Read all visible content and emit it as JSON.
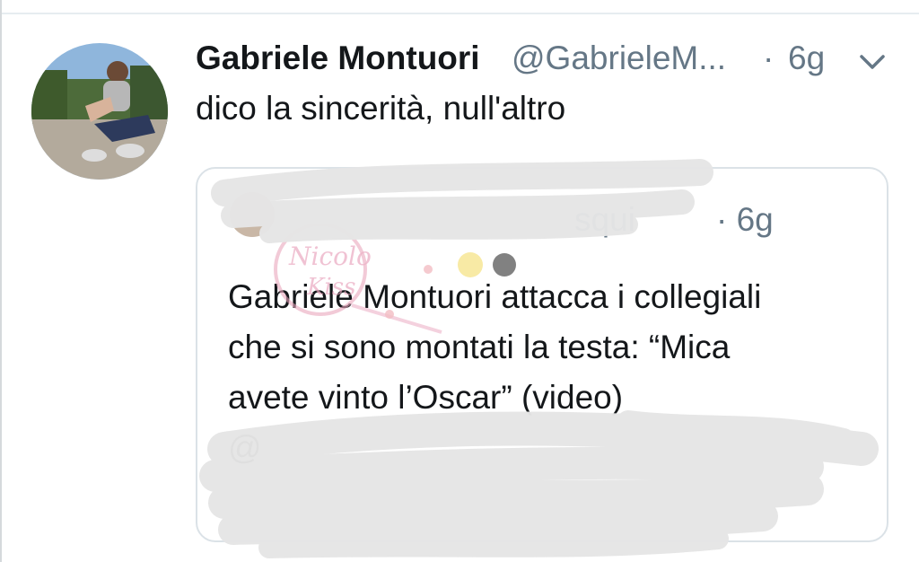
{
  "tweet": {
    "author_name": "Gabriele Montuori",
    "author_handle": "@GabrieleM...",
    "separator": "·",
    "time": "6g",
    "text": "dico la sincerità, null'altro"
  },
  "quoted_tweet": {
    "author_name": "",
    "author_handle_fragment": "squi",
    "time": "· 6g",
    "text_lines": [
      "Gabriele Montuori attacca i collegiali",
      "che si sono montati la testa: “Mica",
      "avete vinto l’Oscar” (video)",
      "@",
      ""
    ]
  },
  "watermark": {
    "text": "Nicolo Kiss"
  },
  "icons": {
    "menu": "chevron-down-icon"
  },
  "colors": {
    "text": "#14171a",
    "secondary": "#657786",
    "border": "#dbe2e7",
    "scribble": "#e9e9e9"
  }
}
